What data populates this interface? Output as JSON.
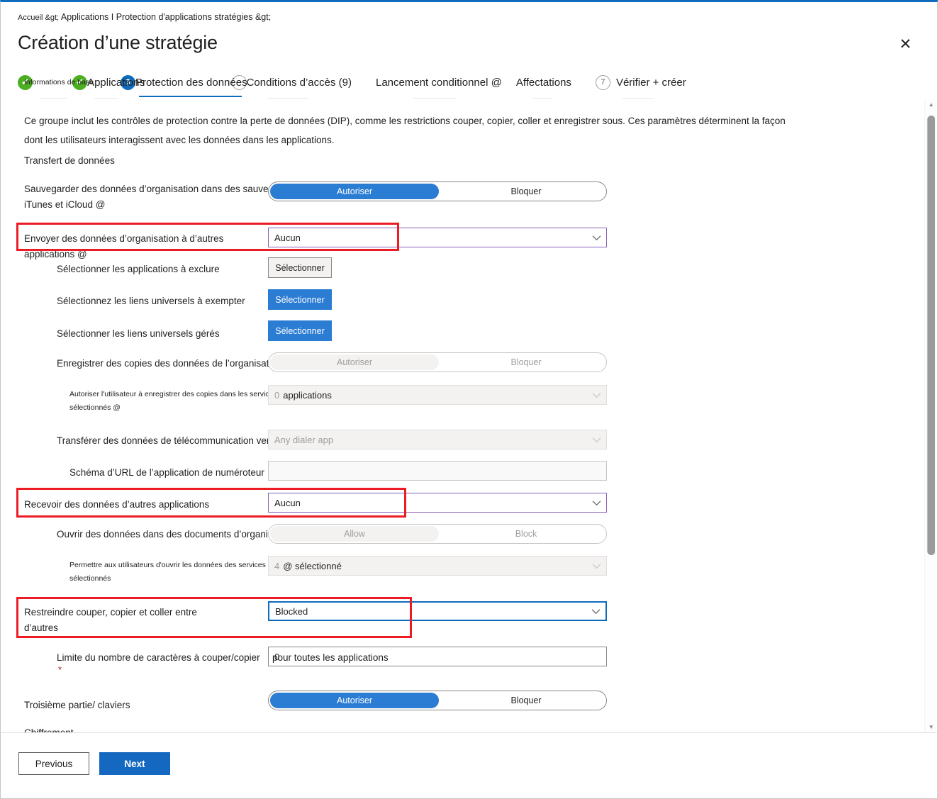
{
  "header": {
    "breadcrumb_root": "Accueil &gt;",
    "breadcrumb_rest": "Applications I Protection d'applications stratégies &gt;",
    "title": "Création d’une stratégie",
    "close_icon": "close-icon"
  },
  "tabs": [
    {
      "marker": "✔",
      "label": "Informations de base",
      "state": "done"
    },
    {
      "marker": "✔",
      "label": "Applications",
      "state": "done"
    },
    {
      "marker": "3",
      "label": "Protection des données",
      "state": "active"
    },
    {
      "marker": "",
      "label": "Conditions d’accès (9)",
      "state": "idle"
    },
    {
      "marker": "",
      "label": "Lancement conditionnel @",
      "state": "plain"
    },
    {
      "marker": "",
      "label": "Affectations",
      "state": "plain"
    },
    {
      "marker": "7",
      "label": "Vérifier + créer",
      "state": "idle"
    }
  ],
  "main": {
    "description": "Ce groupe inclut les contrôles de protection contre la perte de données (DIP), comme les restrictions couper, copier, coller et enregistrer sous. Ces paramètres déterminent la façon dont les utilisateurs interagissent avec les données dans les applications.",
    "section_transfer": "Transfert de données",
    "section_encryption": "Chiffrement"
  },
  "fields": {
    "backup": {
      "label": "Sauvegarder des données d’organisation dans des sauvegardes iTunes et iCloud @",
      "allow": "Autoriser",
      "block": "Bloquer",
      "selected": "Autoriser"
    },
    "send_org_data": {
      "label": "Envoyer des données d’organisation à d’autres applications @",
      "value": "Aucun",
      "highlighted": true
    },
    "select_exempt_apps": {
      "label": "Sélectionner les applications à exclure",
      "button": "Sélectionner"
    },
    "select_exempt_links": {
      "label": "Sélectionnez les liens universels à exempter",
      "button": "Sélectionner"
    },
    "select_managed_links": {
      "label": "Sélectionner les liens universels gérés",
      "button": "Sélectionner"
    },
    "save_copies": {
      "label": "Enregistrer des copies des données de l’organisation @",
      "allow": "Autoriser",
      "block": "Bloquer",
      "selected": "Bloquer"
    },
    "allow_user_save": {
      "label": "Autoriser l'utilisateur à enregistrer des copies dans les services sélectionnés @",
      "count": "0",
      "value": "applications"
    },
    "telecom": {
      "label": "Transférer des données de télécommunication vers @",
      "value": "Any dialer app"
    },
    "dialer_url": {
      "label": "Schéma d’URL de l’application de numéroteur",
      "value": ""
    },
    "receive_data": {
      "label": "Recevoir des données d’autres applications",
      "value": "Aucun",
      "highlighted": true
    },
    "open_data": {
      "label": "Ouvrir des données dans des documents d’organisation @",
      "allow": "Allow",
      "block": "Block",
      "selected": "Allow"
    },
    "allow_user_open": {
      "label": "Permettre aux utilisateurs d'ouvrir les données des services sélectionnés",
      "count": "4",
      "value": "@ sélectionné"
    },
    "restrict_cut_copy": {
      "label": "Restreindre couper, copier et coller entre d’autres",
      "value": "Blocked",
      "highlighted": true
    },
    "char_limit": {
      "label": "Limite du nombre de caractères à couper/copier",
      "label_overflow": "pour toutes les applications",
      "value": "0",
      "required_marker": "*"
    },
    "third_party_keyboards": {
      "label": "Troisième partie/ claviers",
      "allow": "Autoriser",
      "block": "Bloquer",
      "selected": "Autoriser"
    }
  },
  "scrollbar": {
    "up_icon": "chevron-up-icon",
    "down_icon": "chevron-down-icon"
  },
  "footer": {
    "previous": "Previous",
    "next": "Next"
  },
  "colors": {
    "accent_blue": "#0f6cbd",
    "toggle_blue": "#2b7cd3",
    "done_green": "#4caf21",
    "purple_border": "#8764b8",
    "annotation_red": "#ed1c24"
  }
}
